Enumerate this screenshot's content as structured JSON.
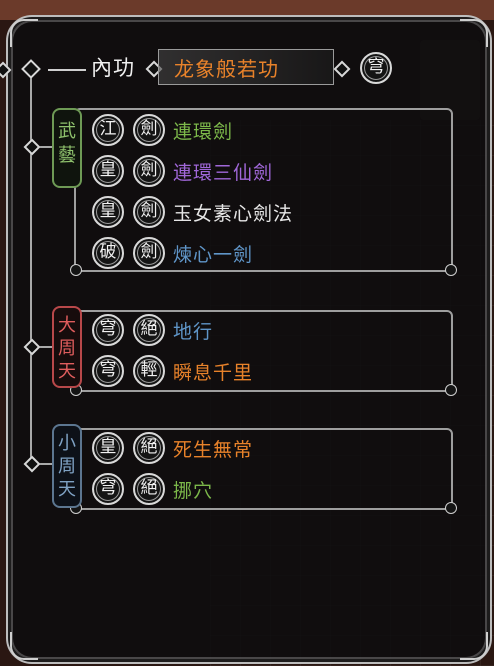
{
  "header": {
    "label": "內功",
    "value": "龙象般若功",
    "badge": "穹"
  },
  "groups": {
    "wuyi": {
      "tag": [
        "武",
        "藝"
      ],
      "rows": [
        {
          "b1": "江",
          "b2": "劍",
          "name": "連環劍",
          "color": "#7cb84a"
        },
        {
          "b1": "皇",
          "b2": "劍",
          "name": "連環三仙劍",
          "color": "#a067d8"
        },
        {
          "b1": "皇",
          "b2": "劍",
          "name": "玉女素心劍法",
          "color": "#e6e6e6"
        },
        {
          "b1": "破",
          "b2": "劍",
          "name": "煉心一劍",
          "color": "#5f95c8"
        }
      ]
    },
    "dazhoutian": {
      "tag": [
        "大",
        "周",
        "天"
      ],
      "rows": [
        {
          "b1": "穹",
          "b2": "絕",
          "name": "地行",
          "color": "#5f95c8"
        },
        {
          "b1": "穹",
          "b2": "輕",
          "name": "瞬息千里",
          "color": "#e8822a"
        }
      ]
    },
    "xiaozhoutian": {
      "tag": [
        "小",
        "周",
        "天"
      ],
      "rows": [
        {
          "b1": "皇",
          "b2": "絕",
          "name": "死生無常",
          "color": "#e8822a"
        },
        {
          "b1": "穹",
          "b2": "絕",
          "name": "挪穴",
          "color": "#7cb84a"
        }
      ]
    }
  }
}
